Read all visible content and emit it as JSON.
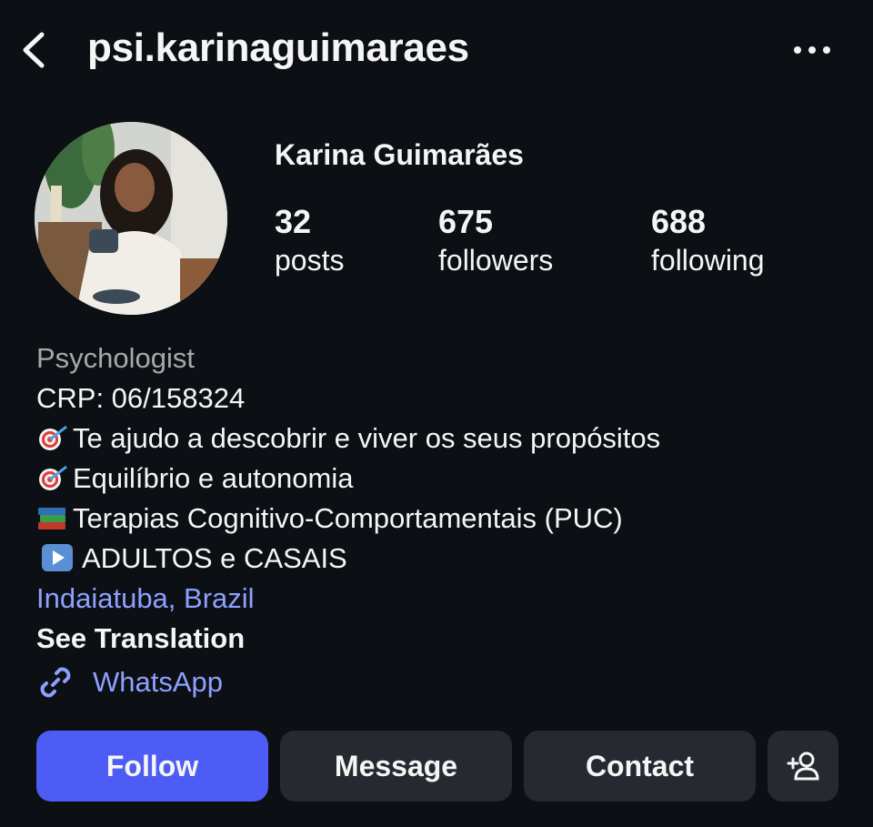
{
  "header": {
    "username": "psi.karinaguimaraes",
    "back_icon": "chevron-left-icon",
    "more_icon": "more-horizontal-icon"
  },
  "profile": {
    "full_name": "Karina Guimarães",
    "stats": [
      {
        "value": "32",
        "label": "posts"
      },
      {
        "value": "675",
        "label": "followers"
      },
      {
        "value": "688",
        "label": "following"
      }
    ]
  },
  "bio": {
    "category": "Psychologist",
    "lines": [
      "CRP: 06/158324",
      "Te ajudo a descobrir e viver os seus propósitos",
      "Equilíbrio e autonomia",
      "Terapias Cognitivo-Comportamentais (PUC)",
      "ADULTOS e CASAIS"
    ],
    "line_icons": [
      "none",
      "target-icon",
      "target-icon",
      "books-icon",
      "play-button-icon"
    ],
    "location": "Indaiatuba, Brazil",
    "see_translation": "See Translation",
    "link_label": "WhatsApp",
    "link_icon": "link-icon"
  },
  "actions": {
    "follow": "Follow",
    "message": "Message",
    "contact": "Contact",
    "add_person_icon": "add-person-icon"
  },
  "colors": {
    "background": "#0c1014",
    "follow_button": "#4c5cf4",
    "secondary_button": "#262a30",
    "link": "#8ea0ff",
    "muted_text": "#a8a8a8"
  }
}
